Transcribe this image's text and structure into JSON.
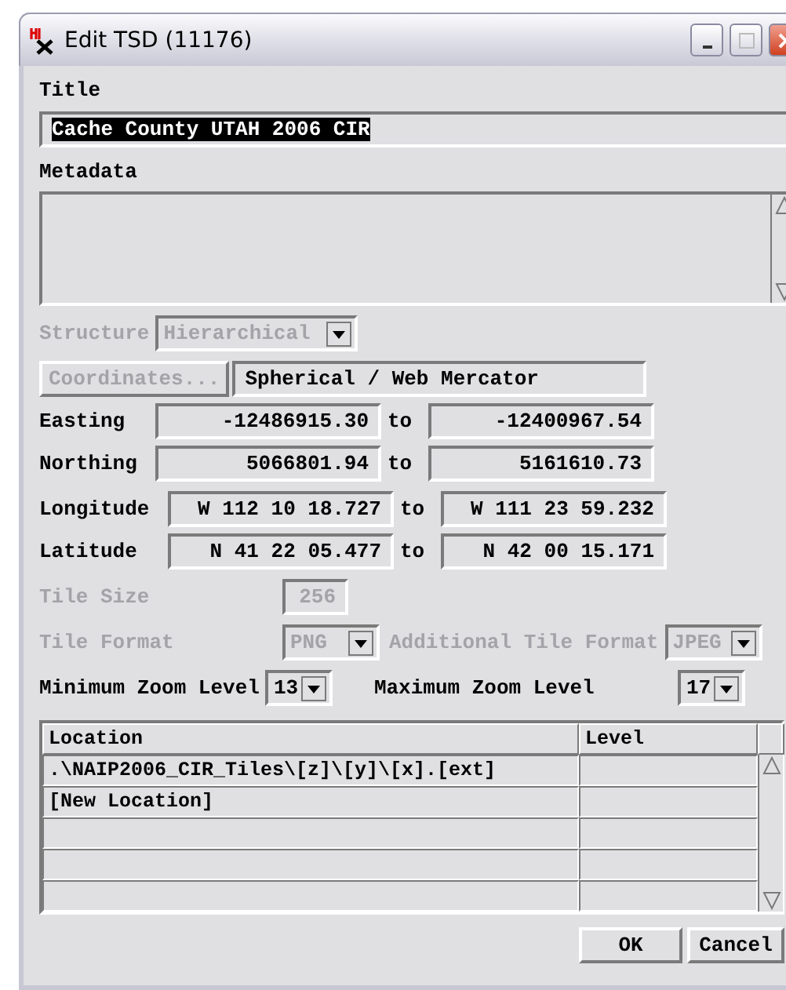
{
  "window": {
    "title": "Edit TSD (11176)"
  },
  "title_field": {
    "label": "Title",
    "value": "Cache County UTAH 2006 CIR",
    "selected": true
  },
  "metadata": {
    "label": "Metadata"
  },
  "structure": {
    "label": "Structure",
    "value": "Hierarchical",
    "disabled": true
  },
  "coordinates": {
    "button": "Coordinates...",
    "disabled": true,
    "value": "Spherical / Web Mercator"
  },
  "ranges": [
    {
      "label": "Easting",
      "from": "-12486915.30",
      "to_label": "to",
      "to": "-12400967.54",
      "kind": "projected"
    },
    {
      "label": "Northing",
      "from": "5066801.94",
      "to_label": "to",
      "to": "5161610.73",
      "kind": "projected"
    },
    {
      "label": "Longitude",
      "from": "W 112 10 18.727",
      "to_label": "to",
      "to": "W 111 23 59.232",
      "kind": "geographic"
    },
    {
      "label": "Latitude",
      "from": "N 41 22 05.477",
      "to_label": "to",
      "to": "N 42 00 15.171",
      "kind": "geographic"
    }
  ],
  "tile_size": {
    "label": "Tile Size",
    "value": "256",
    "disabled": true
  },
  "tile_format": {
    "label": "Tile Format",
    "value": "PNG",
    "disabled": true
  },
  "additional_tile_format": {
    "label": "Additional Tile Format",
    "value": "JPEG",
    "disabled": true
  },
  "zoom": {
    "min_label": "Minimum Zoom Level",
    "min_value": "13",
    "max_label": "Maximum Zoom Level",
    "max_value": "17"
  },
  "table": {
    "columns": [
      "Location",
      "Level"
    ],
    "rows": [
      {
        "location": ".\\NAIP2006_CIR_Tiles\\[z]\\[y]\\[x].[ext]"
      },
      {
        "location": "[New Location]"
      }
    ]
  },
  "buttons": [
    "OK",
    "Cancel"
  ]
}
